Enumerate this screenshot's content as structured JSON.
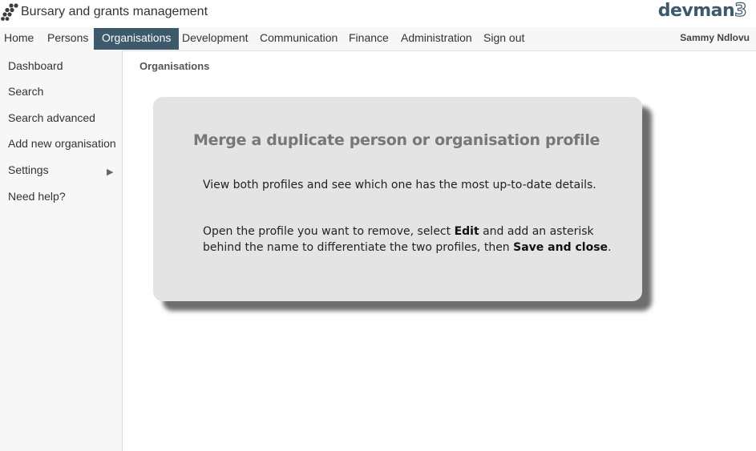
{
  "app": {
    "title": "Bursary and grants management",
    "brand": "devman",
    "brand_suffix": "3"
  },
  "nav": {
    "items": [
      "Home",
      "Persons",
      "Organisations",
      "Development",
      "Communication",
      "Finance",
      "Administration",
      "Sign out"
    ],
    "active": "Organisations",
    "user": "Sammy Ndlovu"
  },
  "sidebar": {
    "items": [
      "Dashboard",
      "Search",
      "Search advanced",
      "Add new organisation",
      "Settings",
      "Need help?"
    ],
    "submenu_arrow": "▶"
  },
  "breadcrumb": "Organisations",
  "card": {
    "title": "Merge a duplicate person or organisation profile",
    "p1": "View both profiles and see which one has the most up-to-date details.",
    "p2_line1_a": "Open the profile you want to remove, select ",
    "p2_edit": "Edit",
    "p2_line1_b": " and add an asterisk",
    "p2_line2_a": "behind the name to differentiate the two profiles, then ",
    "p2_save": "Save and close",
    "p2_end": "."
  },
  "colors": {
    "accent": "#3c5a6b",
    "card_bg": "#e4e4e4",
    "shadow": "#6e6e6e"
  },
  "icons": {
    "app_logo": "grid-dots-logo-icon",
    "submenu": "triangle-right-icon"
  }
}
